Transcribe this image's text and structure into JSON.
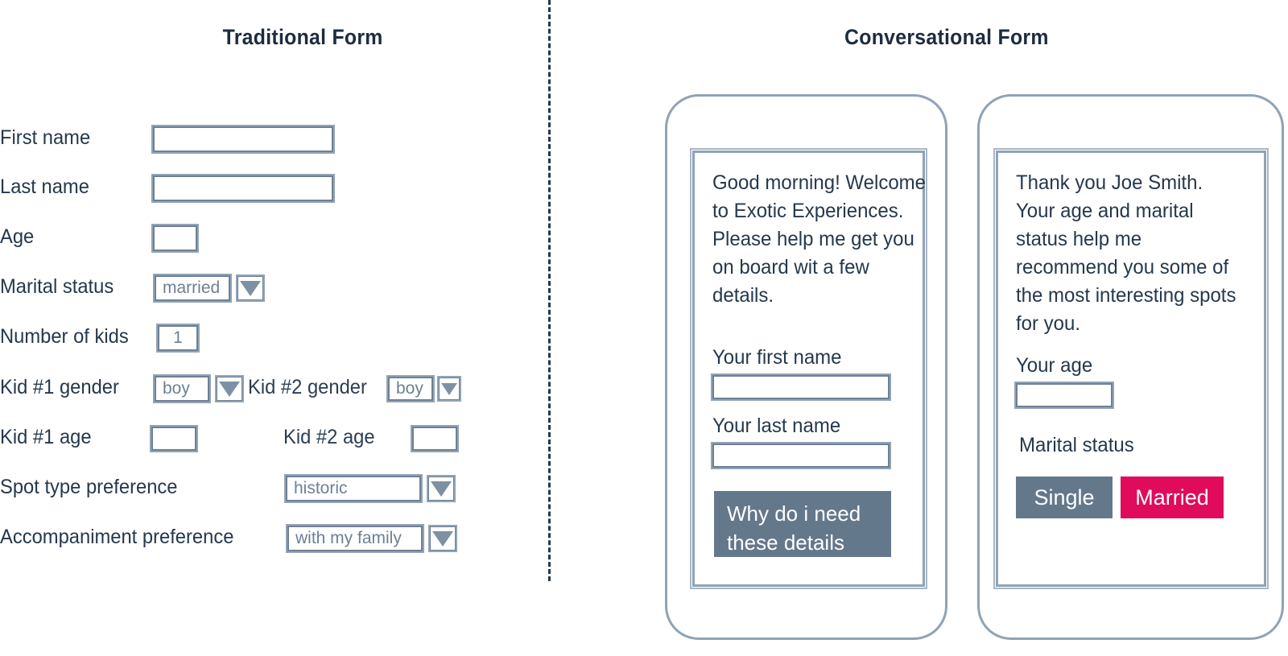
{
  "panels": {
    "traditional": {
      "title": "Traditional Form"
    },
    "conversational": {
      "title": "Conversational Form"
    }
  },
  "colors": {
    "heading": "#1d2c3e",
    "label": "#25384c",
    "outline": "#6e8093",
    "outline_light": "#93a5b7",
    "phone_frame": "#8fa3b5",
    "chip_inactive": "#64788c",
    "chip_active": "#e00b5b",
    "help_button": "#64788c"
  },
  "traditional_form": {
    "rows": [
      {
        "label": "First name",
        "control": "input",
        "value": ""
      },
      {
        "label": "Last name",
        "control": "input",
        "value": ""
      },
      {
        "label": "Age",
        "control": "input",
        "value": ""
      },
      {
        "label": "Marital status",
        "control": "select",
        "value": "married"
      },
      {
        "label": "Number of kids",
        "control": "input",
        "value": "1"
      },
      {
        "label": "Kid #1 gender",
        "control": "select",
        "value": "boy"
      },
      {
        "label": "Kid #2 gender",
        "control": "select",
        "value": "boy"
      },
      {
        "label": "Kid #1 age",
        "control": "input",
        "value": ""
      },
      {
        "label": "Kid #2 age",
        "control": "input",
        "value": ""
      },
      {
        "label": "Spot type preference",
        "control": "select",
        "value": "historic"
      },
      {
        "label": "Accompaniment preference",
        "control": "select",
        "value": "with my family"
      }
    ]
  },
  "phones": [
    {
      "name": "phone-step-1",
      "message": "Good morning! Welcome to Exotic Experiences. Please help me get you on board wit a few details.",
      "fields": [
        {
          "label": "Your first name",
          "value": ""
        },
        {
          "label": "Your last name",
          "value": ""
        }
      ],
      "help_button": "Why do i need these details"
    },
    {
      "name": "phone-step-2",
      "message": "Thank you Joe Smith. Your age and marital status help me recommend you some of the most interesting spots for you.",
      "fields": [
        {
          "label": "Your age",
          "value": ""
        }
      ],
      "choice_label": "Marital status",
      "choices": [
        {
          "label": "Single",
          "selected": false
        },
        {
          "label": "Married",
          "selected": true
        }
      ]
    }
  ]
}
